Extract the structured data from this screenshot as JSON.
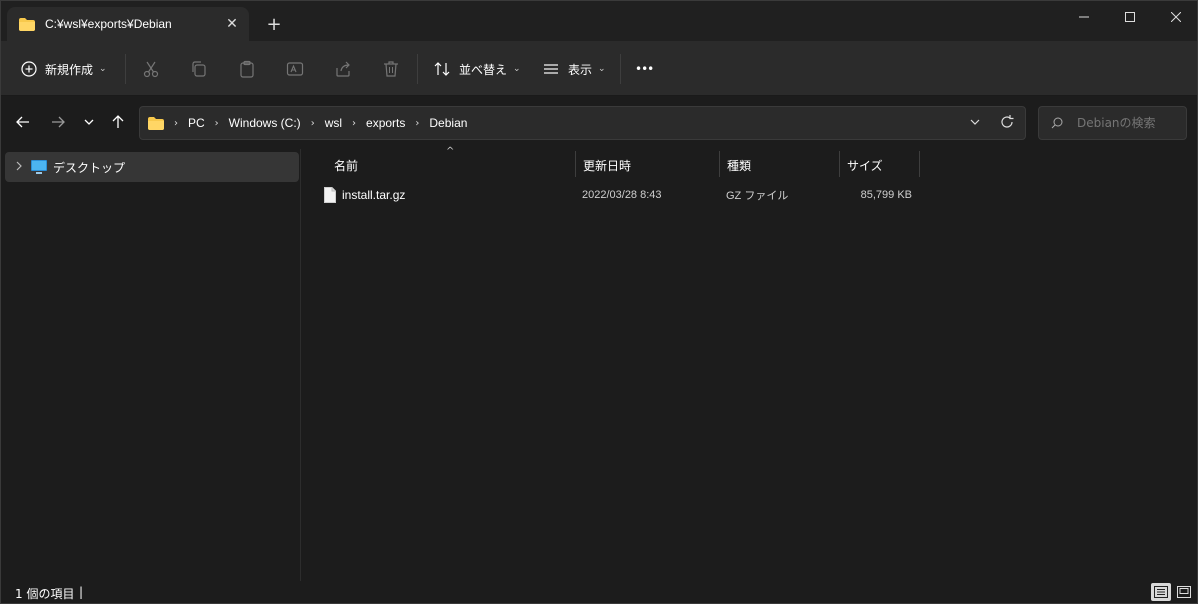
{
  "tab": {
    "title": "C:¥wsl¥exports¥Debian",
    "close": "✕",
    "new": "+"
  },
  "window_controls": {
    "minimize": "—",
    "maximize": "☐",
    "close": "✕"
  },
  "toolbar": {
    "new_label": "新規作成",
    "sort_label": "並べ替え",
    "view_label": "表示",
    "more_label": "•••",
    "chevron": "⌄"
  },
  "address": {
    "crumbs": [
      "PC",
      "Windows (C:)",
      "wsl",
      "exports",
      "Debian"
    ],
    "separator": "›"
  },
  "search": {
    "placeholder": "Debianの検索"
  },
  "sidebar": {
    "items": [
      {
        "label": "デスクトップ",
        "icon": "desktop-icon"
      }
    ]
  },
  "columns": {
    "name": "名前",
    "modified": "更新日時",
    "type": "種類",
    "size": "サイズ",
    "sort_indicator": "^"
  },
  "files": [
    {
      "name": "install.tar.gz",
      "modified": "2022/03/28 8:43",
      "type": "GZ ファイル",
      "size": "85,799 KB"
    }
  ],
  "status": {
    "count": "1 個の項目",
    "cursor": "|"
  },
  "colors": {
    "folder": "#f8c94c",
    "accent": "#60cdff"
  }
}
